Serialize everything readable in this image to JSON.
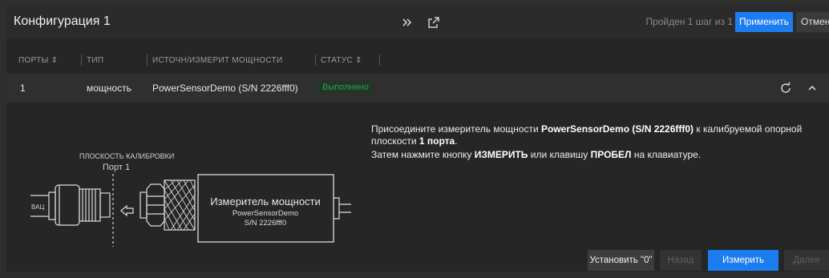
{
  "header": {
    "title": "Конфигурация 1",
    "step_text": "Пройден 1 шаг из 1",
    "apply_label": "Применить",
    "cancel_label": "Отмена"
  },
  "table": {
    "columns": [
      {
        "label": "ПОРТЫ",
        "sort": "⇕"
      },
      {
        "label": "ТИП",
        "sort": ""
      },
      {
        "label": "ИСТОЧН/ИЗМЕРИТ МОЩНОСТИ",
        "sort": ""
      },
      {
        "label": "СТАТУС",
        "sort": "⇕"
      }
    ],
    "rows": [
      {
        "port": "1",
        "type": "мощность",
        "device": "PowerSensorDemo (S/N 2226fff0)",
        "status": "Выполнено"
      }
    ]
  },
  "diagram": {
    "plane_label": "ПЛОСКОСТЬ КАЛИБРОВКИ",
    "port_label": "Порт 1",
    "vna_label": "ВАЦ",
    "meter_title": "Измеритель мощности",
    "meter_model": "PowerSensorDemo",
    "meter_serial": "S/N 2226fff0"
  },
  "instructions": {
    "l1_a": "Присоедините измеритель мощности ",
    "l1_b": "PowerSensorDemo (S/N 2226fff0)",
    "l1_c": " к калибруемой опорной плоскости ",
    "l1_d": "1 порта",
    "l1_e": ".",
    "l2_a": "Затем нажмите кнопку ",
    "l2_b": "ИЗМЕРИТЬ",
    "l2_c": " или клавишу ",
    "l2_d": "ПРОБЕЛ",
    "l2_e": " на клавиатуре."
  },
  "buttons": {
    "zero": "Установить \"0\"",
    "back": "Назад",
    "measure": "Измерить",
    "next": "Далее"
  },
  "colors": {
    "accent": "#1c7df0",
    "status_ok": "#2e9e4f"
  }
}
